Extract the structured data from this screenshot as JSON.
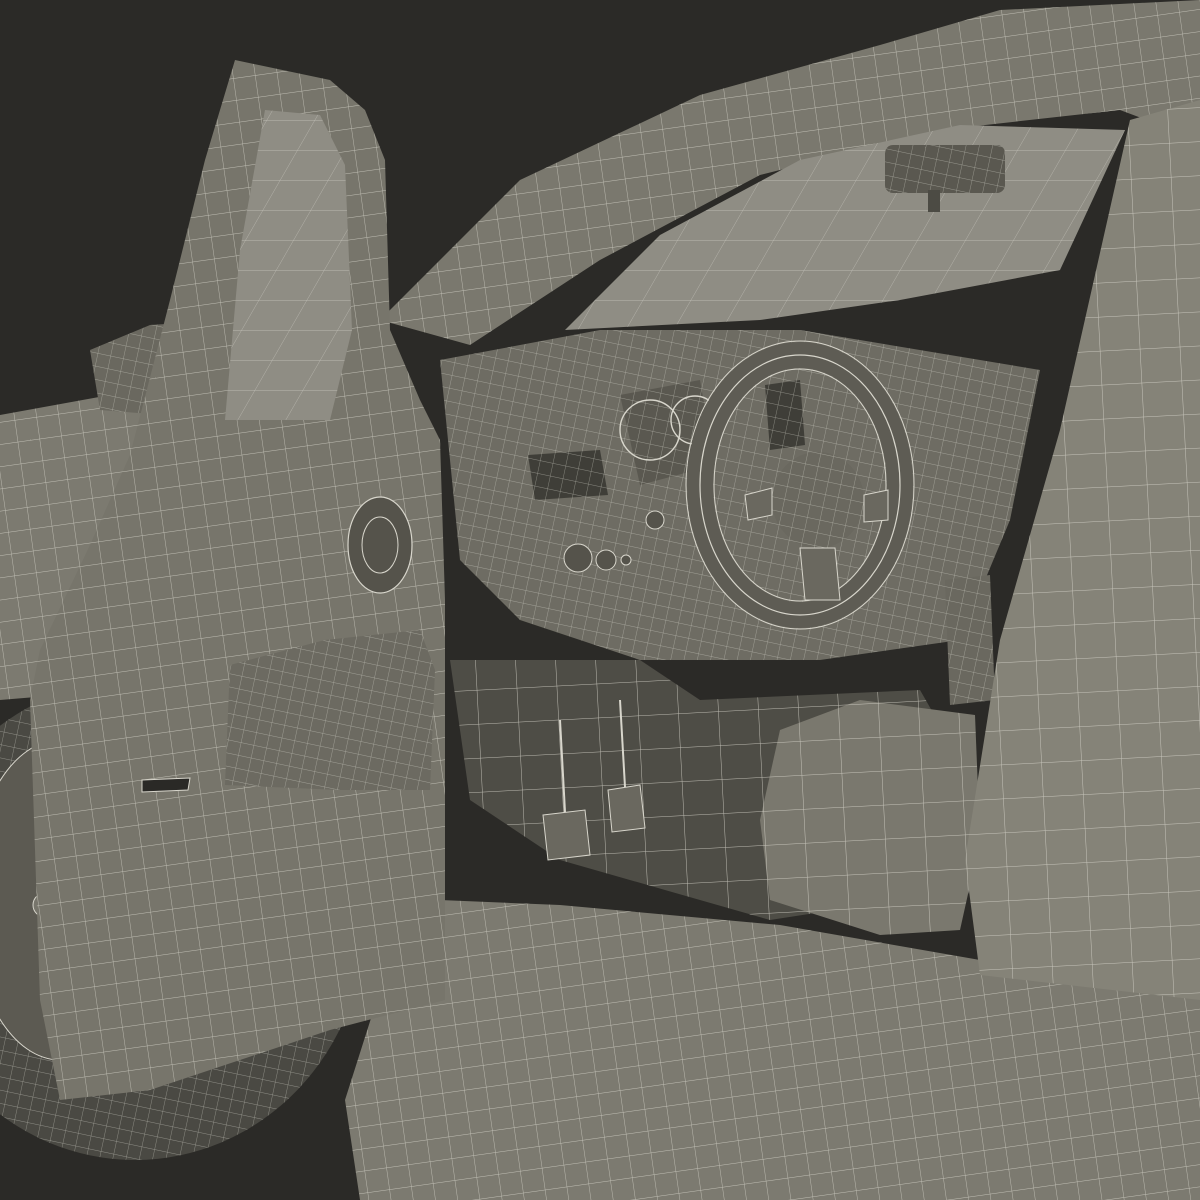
{
  "scene": {
    "background": "#2b2a27",
    "body_fill": "#77756b",
    "shadow_fill": "#4c4b44",
    "glass_fill": "#8f8d84",
    "wire_color": "#d8d6cc"
  }
}
